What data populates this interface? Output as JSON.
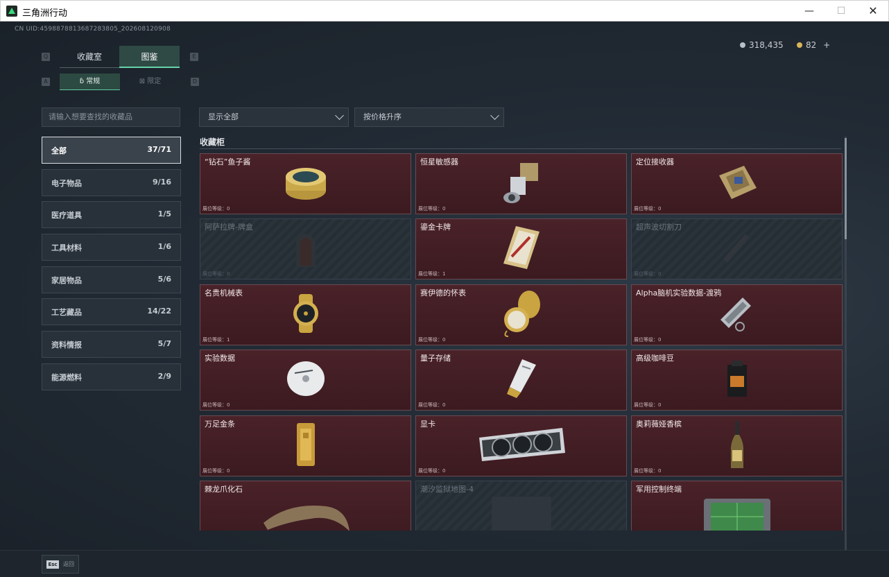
{
  "window": {
    "title": "三角洲行动",
    "minimize": "—",
    "maximize": "☐",
    "close": "✕"
  },
  "header": {
    "uid": "CN UID:4598878813687283805_202608120908",
    "currency1": "318,435",
    "currency2": "82",
    "plus": "+"
  },
  "tabs": {
    "key_left": "Q",
    "key_right": "E",
    "t1": "收藏室",
    "t2": "图鉴"
  },
  "subtabs": {
    "key_left": "A",
    "key_right": "D",
    "s1": "常规",
    "s2": "限定"
  },
  "search": {
    "placeholder": "请输入想要查找的收藏品"
  },
  "filters": {
    "show": "显示全部",
    "sort": "按价格升序"
  },
  "categories": [
    {
      "label": "全部",
      "count": "37/71"
    },
    {
      "label": "电子物品",
      "count": "9/16"
    },
    {
      "label": "医疗道具",
      "count": "1/5"
    },
    {
      "label": "工具材料",
      "count": "1/6"
    },
    {
      "label": "家居物品",
      "count": "5/6"
    },
    {
      "label": "工艺藏品",
      "count": "14/22"
    },
    {
      "label": "资料情报",
      "count": "5/7"
    },
    {
      "label": "能源燃料",
      "count": "2/9"
    }
  ],
  "section": {
    "title": "收藏柜"
  },
  "items": [
    {
      "name": "“钻石”鱼子酱",
      "lvl": "展位等级：0"
    },
    {
      "name": "恒星敏感器",
      "lvl": "展位等级：0"
    },
    {
      "name": "定位接收器",
      "lvl": "展位等级：0"
    },
    {
      "name": "阿萨拉牌-牌盒",
      "lvl": "展位等级：0"
    },
    {
      "name": "鎏金卡牌",
      "lvl": "展位等级：1"
    },
    {
      "name": "超声波切割刀",
      "lvl": "展位等级：0"
    },
    {
      "name": "名贵机械表",
      "lvl": "展位等级：1"
    },
    {
      "name": "赛伊德的怀表",
      "lvl": "展位等级：0"
    },
    {
      "name": "Alpha脑机实验数据-渡鸦",
      "lvl": "展位等级：0"
    },
    {
      "name": "实验数据",
      "lvl": "展位等级：0"
    },
    {
      "name": "量子存储",
      "lvl": "展位等级：0"
    },
    {
      "name": "高级咖啡豆",
      "lvl": "展位等级：0"
    },
    {
      "name": "万足金条",
      "lvl": "展位等级：0"
    },
    {
      "name": "显卡",
      "lvl": "展位等级：0"
    },
    {
      "name": "奥莉薇娅香槟",
      "lvl": "展位等级：0"
    },
    {
      "name": "棘龙爪化石",
      "lvl": ""
    },
    {
      "name": "潮汐监狱地图-4",
      "lvl": ""
    },
    {
      "name": "军用控制终端",
      "lvl": ""
    }
  ],
  "footer": {
    "esc_key": "Esc",
    "esc_label": "返回"
  }
}
